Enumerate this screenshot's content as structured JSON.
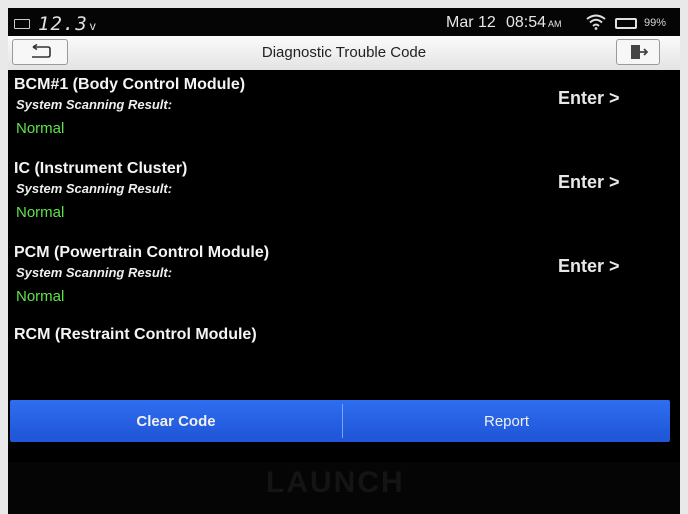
{
  "status_bar": {
    "voltage": "12.3",
    "voltage_unit": "v",
    "date": "Mar 12",
    "time": "08:54",
    "ampm": "AM",
    "battery_percent": "99%",
    "icons": [
      "battery-status-icon",
      "wifi-icon",
      "battery-icon"
    ]
  },
  "title_bar": {
    "title": "Diagnostic Trouble Code",
    "back_icon": "return-arrow-icon",
    "exit_icon": "exit-door-icon"
  },
  "modules": [
    {
      "name": "BCM#1 (Body Control Module)",
      "subtitle": "System Scanning Result:",
      "status": "Normal",
      "action": "Enter >"
    },
    {
      "name": "IC (Instrument Cluster)",
      "subtitle": "System Scanning Result:",
      "status": "Normal",
      "action": "Enter >"
    },
    {
      "name": "PCM (Powertrain Control Module)",
      "subtitle": "System Scanning Result:",
      "status": "Normal",
      "action": "Enter >"
    },
    {
      "name": "RCM (Restraint Control Module)",
      "subtitle": "",
      "status": "",
      "action": ""
    }
  ],
  "bottom_bar": {
    "clear_code": "Clear Code",
    "report": "Report"
  },
  "device": {
    "brand": "LAUNCH"
  },
  "colors": {
    "status_normal": "#5fe34a",
    "bottom_bar": "#2563e8",
    "screen_bg": "#000000"
  }
}
